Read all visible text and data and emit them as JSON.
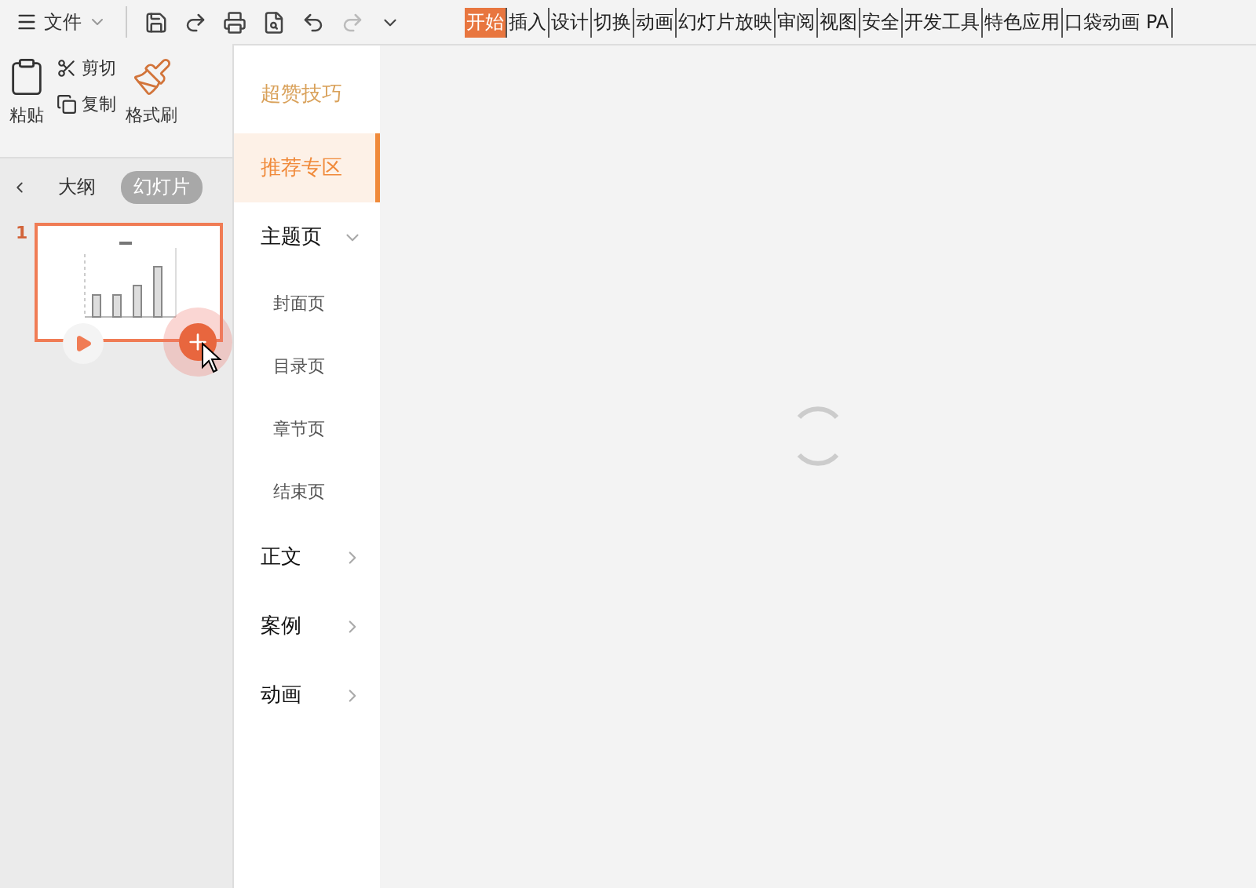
{
  "menu": {
    "file": "文件",
    "tabs": [
      {
        "label": "开始",
        "selected": true
      },
      {
        "label": "插入",
        "selected": false
      },
      {
        "label": "设计",
        "selected": false
      },
      {
        "label": "切换",
        "selected": false
      },
      {
        "label": "动画",
        "selected": false
      },
      {
        "label": "幻灯片放映",
        "selected": false
      },
      {
        "label": "审阅",
        "selected": false
      },
      {
        "label": "视图",
        "selected": false
      },
      {
        "label": "安全",
        "selected": false
      },
      {
        "label": "开发工具",
        "selected": false
      },
      {
        "label": "特色应用",
        "selected": false
      },
      {
        "label": "口袋动画 PA",
        "selected": false
      }
    ]
  },
  "ribbon": {
    "paste": "粘贴",
    "cut": "剪切",
    "copy": "复制",
    "format_painter": "格式刷"
  },
  "slides_panel": {
    "tabs": [
      {
        "label": "大纲",
        "selected": false
      },
      {
        "label": "幻灯片",
        "selected": true
      }
    ],
    "slides": [
      {
        "number": "1",
        "selected": true
      }
    ]
  },
  "tips_panel": {
    "title": "超赞技巧",
    "items": [
      {
        "label": "推荐专区",
        "selected": true
      },
      {
        "label": "主题页",
        "selected": false,
        "expanded": true,
        "children": [
          {
            "label": "封面页"
          },
          {
            "label": "目录页"
          },
          {
            "label": "章节页"
          },
          {
            "label": "结束页"
          }
        ]
      },
      {
        "label": "正文",
        "selected": false,
        "expanded": false
      },
      {
        "label": "案例",
        "selected": false,
        "expanded": false
      },
      {
        "label": "动画",
        "selected": false,
        "expanded": false
      }
    ]
  }
}
